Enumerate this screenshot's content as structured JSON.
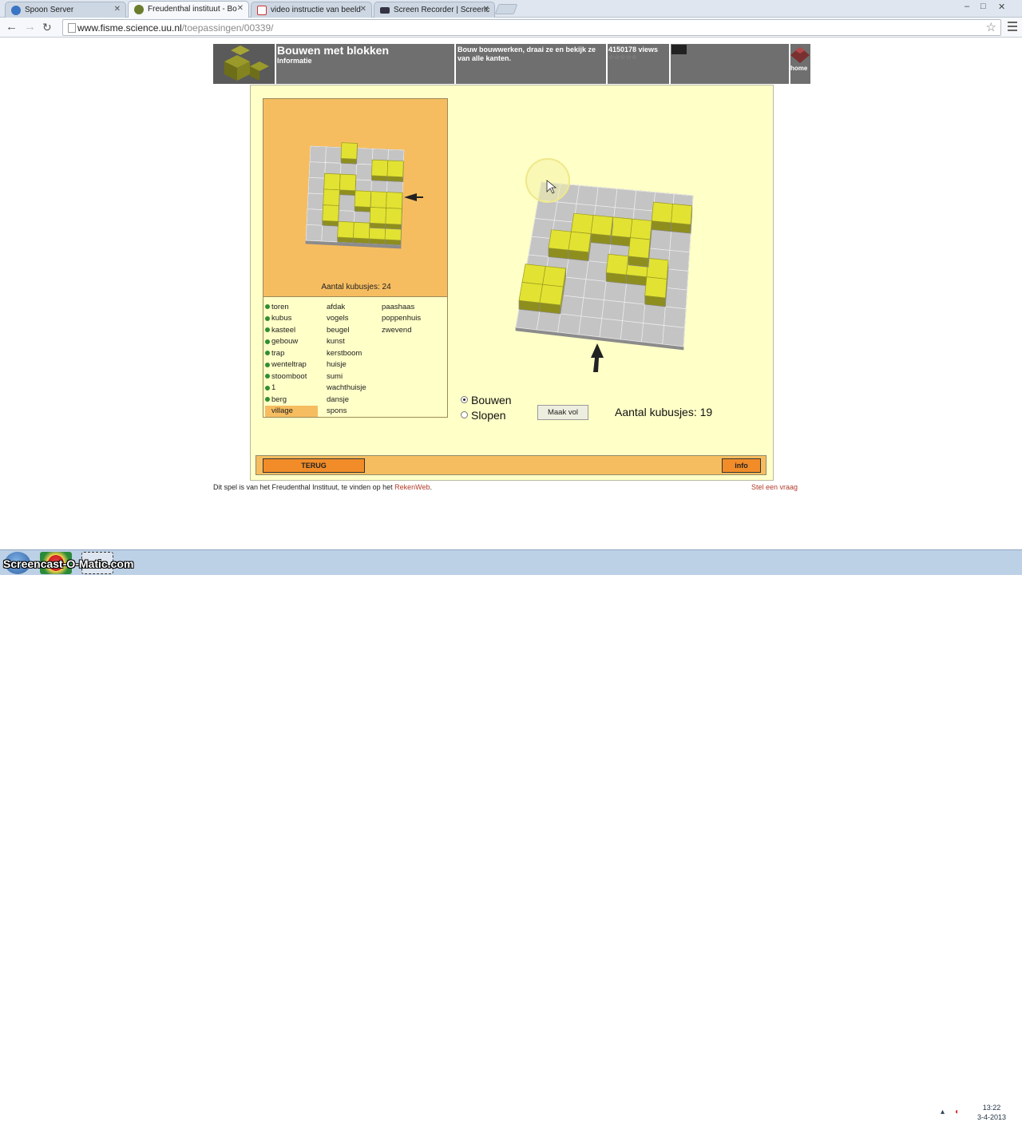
{
  "browser": {
    "tabs": [
      {
        "label": "Spoon Server",
        "active": false,
        "icon": "spoon-icon"
      },
      {
        "label": "Freudenthal instituut - Bo",
        "active": true,
        "icon": "fisme-icon"
      },
      {
        "label": "video instructie van beeld",
        "active": false,
        "icon": "gmail-icon"
      },
      {
        "label": "Screen Recorder | Screenc",
        "active": false,
        "icon": "som-icon"
      }
    ],
    "url_host": "www.fisme.science.uu.nl",
    "url_path": "/toepassingen/00339/",
    "window_controls": {
      "minimize": "–",
      "maximize": "□",
      "close": "✕"
    }
  },
  "header": {
    "title": "Bouwen met blokken",
    "subtitle": "Informatie",
    "description": "Bouw bouwwerken, draai ze en bekijk ze van alle kanten.",
    "views": "4150178 views",
    "stars": "☆☆☆☆☆",
    "home": "home"
  },
  "game": {
    "preview_count": "Aantal kubusjes: 24",
    "list_columns": [
      [
        {
          "label": "toren",
          "dot": true
        },
        {
          "label": "kubus",
          "dot": true
        },
        {
          "label": "kasteel",
          "dot": true
        },
        {
          "label": "gebouw",
          "dot": true
        },
        {
          "label": "trap",
          "dot": true
        },
        {
          "label": "wenteltrap",
          "dot": true
        },
        {
          "label": "stoomboot",
          "dot": true
        },
        {
          "label": "1",
          "dot": true
        },
        {
          "label": "berg",
          "dot": true
        },
        {
          "label": "village",
          "dot": false,
          "selected": true
        }
      ],
      [
        {
          "label": "afdak"
        },
        {
          "label": "vogels"
        },
        {
          "label": "beugel"
        },
        {
          "label": "kunst"
        },
        {
          "label": "kerstboom"
        },
        {
          "label": "huisje"
        },
        {
          "label": "sumi"
        },
        {
          "label": "wachthuisje"
        },
        {
          "label": "dansje"
        },
        {
          "label": "spons"
        }
      ],
      [
        {
          "label": "paashaas"
        },
        {
          "label": "poppenhuis"
        },
        {
          "label": "zwevend"
        }
      ]
    ],
    "mode_build": "Bouwen",
    "mode_demolish": "Slopen",
    "mode_selected": "build",
    "fill_button": "Maak vol",
    "count": "Aantal kubusjes: 19",
    "back_button": "TERUG",
    "info_button": "info"
  },
  "footer": {
    "text_before": "Dit spel is van het Freudenthal Instituut, te vinden op het ",
    "link": "RekenWeb",
    "text_after": ".",
    "ask": "Stel een vraag"
  },
  "taskbar": {
    "overlay": "Screencast-O-Matic.com",
    "time": "13:22",
    "date": "3-4-2013"
  },
  "colors": {
    "block": "#e2e233",
    "grid": "#b9b9b9",
    "panel": "#f6bd60",
    "background": "#ffffc8",
    "button": "#f28c28"
  }
}
